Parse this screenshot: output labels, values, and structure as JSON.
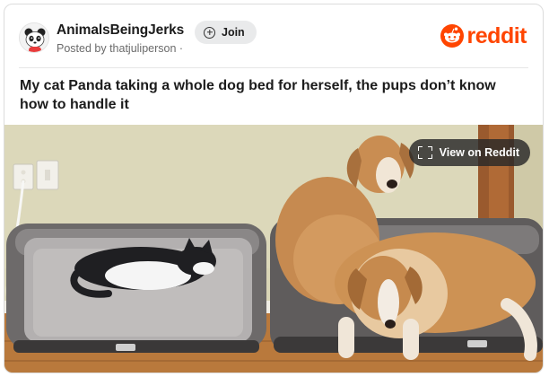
{
  "subreddit": {
    "name": "AnimalsBeingJerks",
    "posted_by": "Posted by thatjuliperson ·",
    "avatar_icon": "panda-avatar-icon"
  },
  "header": {
    "join_label": "Join",
    "join_icon": "plus-circle-icon",
    "logo_text": "reddit",
    "logo_icon": "reddit-alien-icon",
    "brand_color": "#ff4500"
  },
  "post": {
    "title": "My cat Panda taking a whole dog bed for herself, the pups don’t know how to handle it",
    "view_label": "View on Reddit",
    "view_icon": "expand-icon",
    "image_subject": "cat-and-two-dogs-on-dog-beds"
  }
}
